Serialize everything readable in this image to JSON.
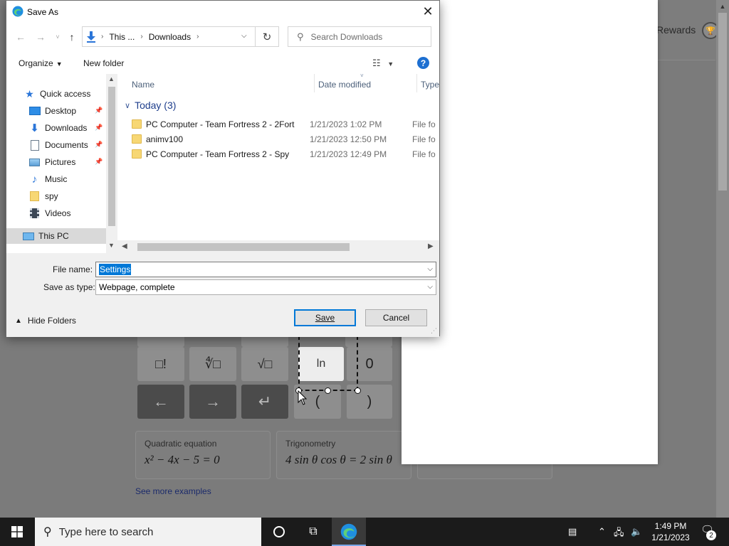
{
  "background": {
    "rewards_label": "Rewards",
    "keys_row1": [
      "□!",
      "∜□",
      "√□",
      "ln",
      "0"
    ],
    "keys_row2": [
      "←",
      "→",
      "↵",
      "(",
      ")"
    ],
    "examples": [
      {
        "title": "Quadratic equation",
        "formula": "x² − 4x − 5 = 0"
      },
      {
        "title": "Trigonometry",
        "formula": "4 sin θ cos θ = 2 sin θ"
      }
    ],
    "see_more": "See more examples"
  },
  "dialog": {
    "title": "Save As",
    "address": {
      "segment1": "This ...",
      "segment2": "Downloads"
    },
    "search_placeholder": "Search Downloads",
    "toolbar": {
      "organize": "Organize",
      "new_folder": "New folder"
    },
    "nav_items": [
      {
        "label": "Quick access",
        "icon": "star-icon"
      },
      {
        "label": "Desktop",
        "icon": "desktop-icon",
        "pinned": true
      },
      {
        "label": "Downloads",
        "icon": "download-icon",
        "pinned": true
      },
      {
        "label": "Documents",
        "icon": "document-icon",
        "pinned": true
      },
      {
        "label": "Pictures",
        "icon": "picture-icon",
        "pinned": true
      },
      {
        "label": "Music",
        "icon": "music-icon"
      },
      {
        "label": "spy",
        "icon": "folder-icon"
      },
      {
        "label": "Videos",
        "icon": "video-icon"
      },
      {
        "label": "This PC",
        "icon": "computer-icon",
        "selected": true
      }
    ],
    "columns": {
      "name": "Name",
      "date": "Date modified",
      "type": "Type"
    },
    "group": "Today (3)",
    "files": [
      {
        "name": "PC Computer - Team Fortress 2 - 2Fort",
        "date": "1/21/2023 1:02 PM",
        "type": "File fo"
      },
      {
        "name": "animv100",
        "date": "1/21/2023 12:50 PM",
        "type": "File fo"
      },
      {
        "name": "PC Computer - Team Fortress 2 - Spy",
        "date": "1/21/2023 12:49 PM",
        "type": "File fo"
      }
    ],
    "file_name_label": "File name:",
    "file_name_value": "Settings",
    "save_type_label": "Save as type:",
    "save_type_value": "Webpage, complete",
    "hide_folders": "Hide Folders",
    "save_button": "Save",
    "cancel_button": "Cancel"
  },
  "taskbar": {
    "search_placeholder": "Type here to search",
    "time": "1:49 PM",
    "date": "1/21/2023",
    "notifications": "2"
  },
  "colors": {
    "accent": "#0078d7",
    "folder": "#f7d774",
    "taskbar": "#1b1b1b"
  }
}
